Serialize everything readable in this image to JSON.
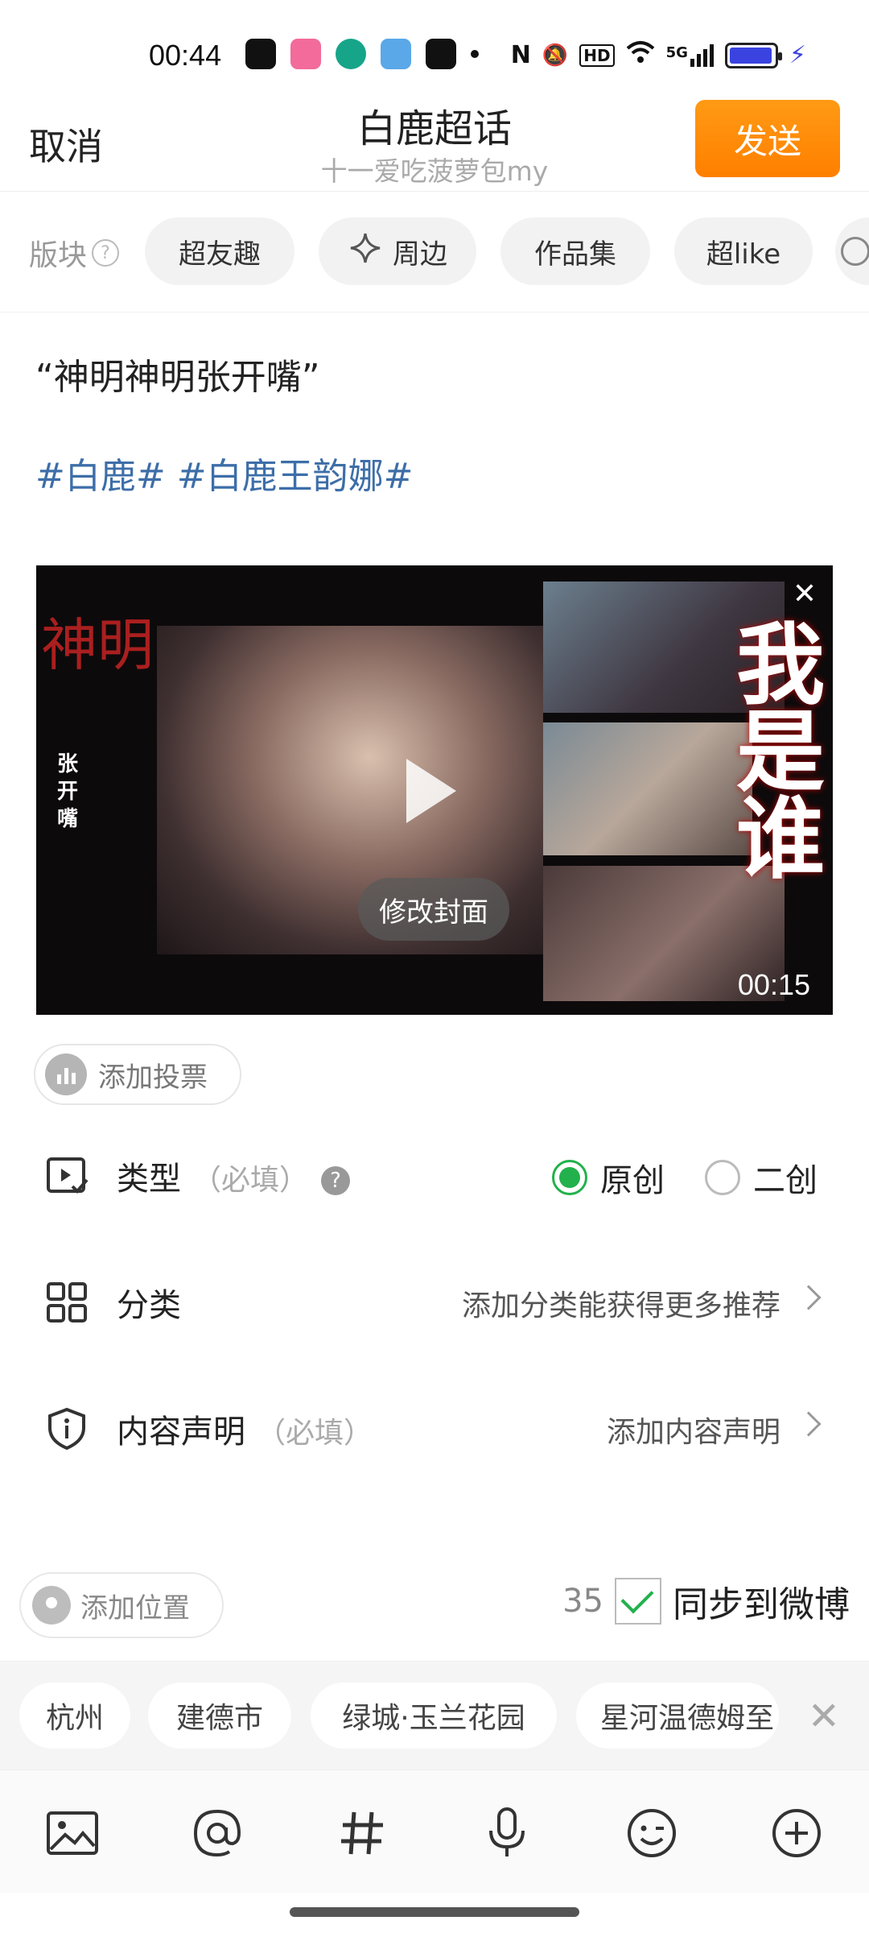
{
  "status_bar": {
    "time": "00:44",
    "network": "5G",
    "hd": "HD"
  },
  "header": {
    "cancel_label": "取消",
    "title": "白鹿超话",
    "subtitle": "十一爱吃菠萝包my",
    "send_label": "发送"
  },
  "sections": {
    "label": "版块",
    "items": [
      "超友趣",
      "周边",
      "作品集",
      "超like"
    ]
  },
  "post": {
    "quote": "“神明神明张开嘴”",
    "tags": "#白鹿# #白鹿王韵娜#"
  },
  "video": {
    "cover_button": "修改封面",
    "duration": "00:15",
    "left_big": "神明",
    "left_small": "张开嘴",
    "right_big": "我是谁"
  },
  "vote": {
    "label": "添加投票"
  },
  "type_row": {
    "label": "类型",
    "required": "（必填）",
    "options": [
      "原创",
      "二创"
    ],
    "selected": "原创"
  },
  "category_row": {
    "label": "分类",
    "hint": "添加分类能获得更多推荐"
  },
  "statement_row": {
    "label": "内容声明",
    "required": "（必填）",
    "hint": "添加内容声明"
  },
  "location": {
    "button_label": "添加位置",
    "suggestions": [
      "杭州",
      "建德市",
      "绿城·玉兰花园",
      "星河温德姆至"
    ]
  },
  "sync": {
    "count": "35",
    "label": "同步到微博",
    "checked": true
  },
  "toolbar": {
    "items": [
      "image-icon",
      "mention-icon",
      "hashtag-icon",
      "microphone-icon",
      "emoji-icon",
      "add-icon"
    ]
  },
  "colors": {
    "accent": "#ff8a0a",
    "tag_blue": "#3d6ea8",
    "selected_green": "#22b14c"
  }
}
